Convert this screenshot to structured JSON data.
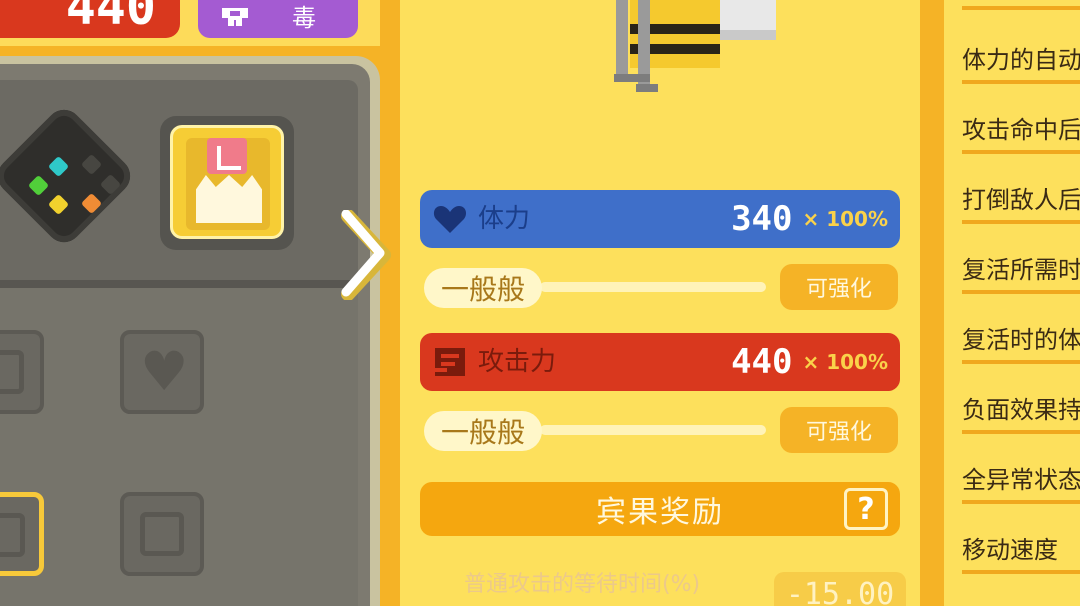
{
  "header": {
    "power_value": "440",
    "type_label": "毒"
  },
  "stats": {
    "hp": {
      "label": "体力",
      "value": "340",
      "multiplier": "× 100%",
      "rank": "一般般",
      "upgrade": "可强化"
    },
    "attack": {
      "label": "攻击力",
      "value": "440",
      "multiplier": "× 100%",
      "rank": "一般般",
      "upgrade": "可强化"
    }
  },
  "bingo": {
    "label": "宾果奖励",
    "help": "?"
  },
  "bonus": {
    "label": "普通攻击的等待时间(%)",
    "value": "-15.00"
  },
  "skill_list": [
    "体力的自动",
    "攻击命中后",
    "打倒敌人后",
    "复活所需时",
    "复活时的体",
    "负面效果持",
    "全异常状态",
    "移动速度"
  ],
  "colors": {
    "background": "#f5b326",
    "panel": "#fde05c",
    "hp_bar": "#3f6fc9",
    "attack_bar": "#d9381e",
    "type_poison": "#a45bd2"
  },
  "icons": {
    "hp": "heart-icon",
    "attack": "fist-icon",
    "next": "chevron-right-icon",
    "type": "poison-type-icon"
  }
}
